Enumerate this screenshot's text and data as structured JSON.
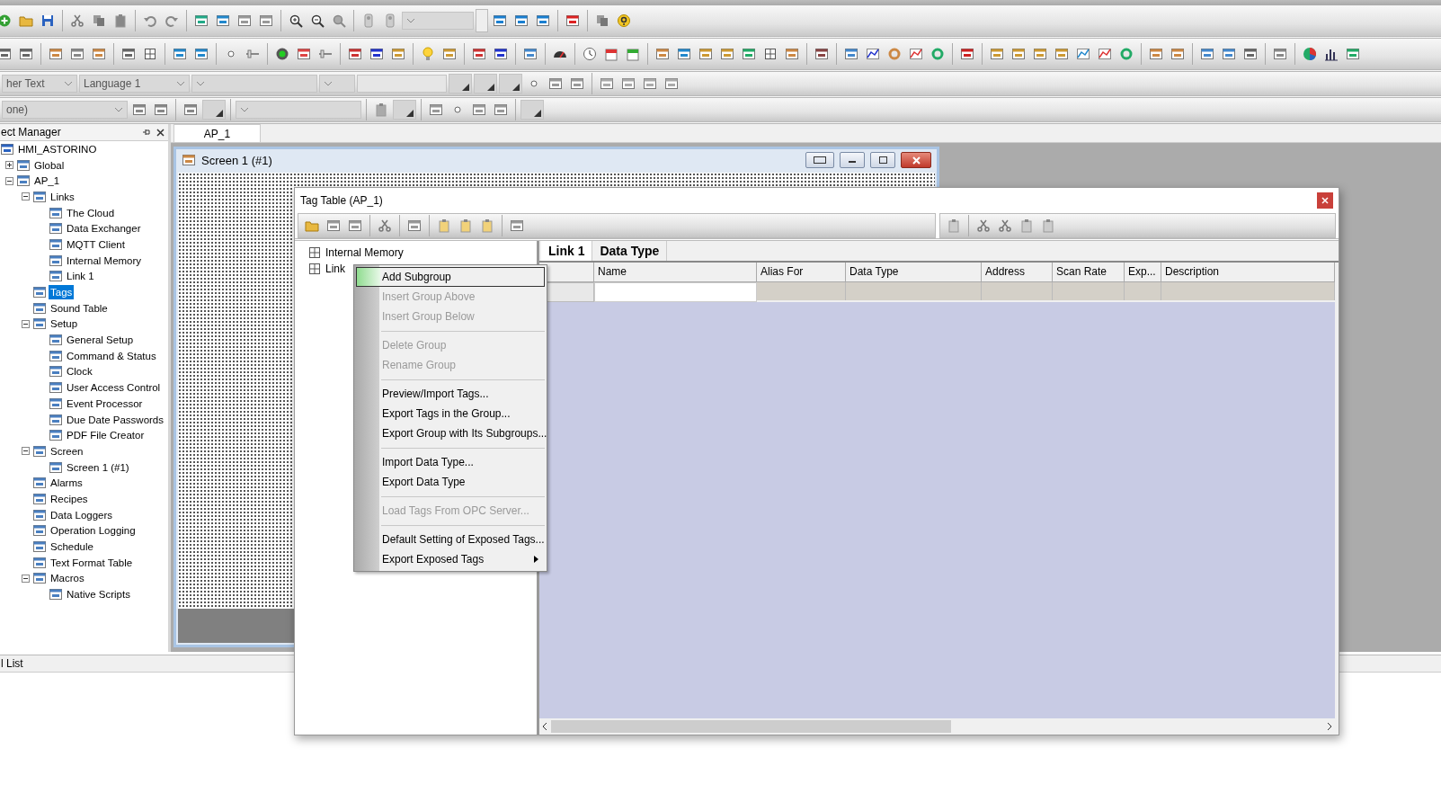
{
  "toolbar": {
    "dropdown_1": "her Text",
    "language_dropdown": "Language 1",
    "dropdown_3": "one)"
  },
  "project_manager": {
    "title": "ect Manager",
    "tree": [
      {
        "label": "HMI_ASTORINO",
        "selected": false,
        "children": [
          {
            "label": "Global",
            "selected": false,
            "expanded": false
          },
          {
            "label": "AP_1",
            "selected": false,
            "expanded": true,
            "children": [
              {
                "label": "Links",
                "selected": false,
                "expanded": true,
                "children": [
                  {
                    "label": "The Cloud",
                    "selected": false
                  },
                  {
                    "label": "Data Exchanger",
                    "selected": false
                  },
                  {
                    "label": "MQTT Client",
                    "selected": false
                  },
                  {
                    "label": "Internal Memory",
                    "selected": false
                  },
                  {
                    "label": "Link 1",
                    "selected": false
                  }
                ]
              },
              {
                "label": "Tags",
                "selected": true
              },
              {
                "label": "Sound Table",
                "selected": false
              },
              {
                "label": "Setup",
                "selected": false,
                "expanded": true,
                "children": [
                  {
                    "label": "General Setup",
                    "selected": false
                  },
                  {
                    "label": "Command & Status",
                    "selected": false
                  },
                  {
                    "label": "Clock",
                    "selected": false
                  },
                  {
                    "label": "User Access Control",
                    "selected": false
                  },
                  {
                    "label": "Event Processor",
                    "selected": false
                  },
                  {
                    "label": "Due Date Passwords",
                    "selected": false
                  },
                  {
                    "label": "PDF File Creator",
                    "selected": false
                  }
                ]
              },
              {
                "label": "Screen",
                "selected": false,
                "expanded": true,
                "children": [
                  {
                    "label": "Screen 1 (#1)",
                    "selected": false
                  }
                ]
              },
              {
                "label": "Alarms",
                "selected": false
              },
              {
                "label": "Recipes",
                "selected": false
              },
              {
                "label": "Data Loggers",
                "selected": false
              },
              {
                "label": "Operation Logging",
                "selected": false
              },
              {
                "label": "Schedule",
                "selected": false
              },
              {
                "label": "Text Format Table",
                "selected": false
              },
              {
                "label": "Macros",
                "selected": false,
                "expanded": true,
                "children": [
                  {
                    "label": "Native Scripts",
                    "selected": false
                  }
                ]
              }
            ]
          }
        ]
      }
    ]
  },
  "document_tabs": [
    {
      "label": "AP_1",
      "selected": true
    }
  ],
  "screen_window": {
    "title": "Screen 1 (#1)"
  },
  "tag_table": {
    "title": "Tag Table (AP_1)",
    "tree": [
      {
        "label": "Internal Memory"
      },
      {
        "label": "Link"
      }
    ],
    "tabs": [
      {
        "label": "Link 1",
        "selected": true
      },
      {
        "label": "Data Type",
        "selected": false
      }
    ],
    "columns": [
      "Name",
      "Alias For",
      "Data Type",
      "Address",
      "Scan Rate",
      "Exp...",
      "Description"
    ]
  },
  "context_menu": [
    {
      "kind": "item",
      "label": "Add Subgroup",
      "disabled": false,
      "selected": true,
      "submenu": false
    },
    {
      "kind": "item",
      "label": "Insert Group Above",
      "disabled": true,
      "selected": false,
      "submenu": false
    },
    {
      "kind": "item",
      "label": "Insert Group Below",
      "disabled": true,
      "selected": false,
      "submenu": false
    },
    {
      "kind": "separator"
    },
    {
      "kind": "item",
      "label": "Delete Group",
      "disabled": true,
      "selected": false,
      "submenu": false
    },
    {
      "kind": "item",
      "label": "Rename Group",
      "disabled": true,
      "selected": false,
      "submenu": false
    },
    {
      "kind": "separator"
    },
    {
      "kind": "item",
      "label": "Preview/Import Tags...",
      "disabled": false,
      "selected": false,
      "submenu": false
    },
    {
      "kind": "item",
      "label": "Export Tags in the Group...",
      "disabled": false,
      "selected": false,
      "submenu": false
    },
    {
      "kind": "item",
      "label": "Export Group with Its Subgroups...",
      "disabled": false,
      "selected": false,
      "submenu": false
    },
    {
      "kind": "separator"
    },
    {
      "kind": "item",
      "label": "Import Data Type...",
      "disabled": false,
      "selected": false,
      "submenu": false
    },
    {
      "kind": "item",
      "label": "Export Data Type",
      "disabled": false,
      "selected": false,
      "submenu": false
    },
    {
      "kind": "separator"
    },
    {
      "kind": "item",
      "label": "Load Tags From OPC Server...",
      "disabled": true,
      "selected": false,
      "submenu": false
    },
    {
      "kind": "separator"
    },
    {
      "kind": "item",
      "label": "Default Setting of Exposed Tags...",
      "disabled": false,
      "selected": false,
      "submenu": false
    },
    {
      "kind": "item",
      "label": "Export Exposed Tags",
      "disabled": false,
      "selected": false,
      "submenu": true
    }
  ],
  "bottom_panel": {
    "title": "l List"
  }
}
